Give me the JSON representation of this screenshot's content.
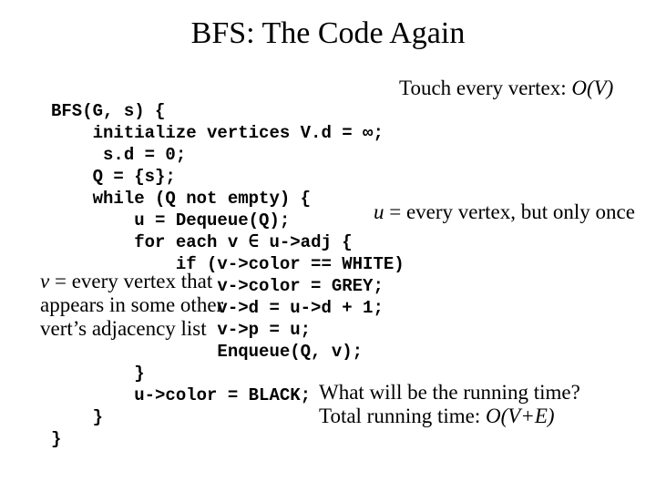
{
  "title": "BFS: The Code Again",
  "code": {
    "l0": "BFS(G, s) {",
    "l1": "    initialize vertices V.d = ∞;",
    "l2": "     s.d = 0;",
    "l3": "    Q = {s};",
    "l4": "    while (Q not empty) {",
    "l5": "        u = Dequeue(Q);",
    "l6": "        for each v ∈ u->adj {",
    "l7": "            if (v->color == WHITE)",
    "l8": "                v->color = GREY;",
    "l9": "                v->d = u->d + 1;",
    "l10": "                v->p = u;",
    "l11": "                Enqueue(Q, v);",
    "l12": "        }",
    "l13": "        u->color = BLACK;",
    "l14": "    }",
    "l15": "}"
  },
  "annotations": {
    "touch_prefix": "Touch every vertex: ",
    "touch_bigO": "O(V)",
    "u_var": "u",
    "u_rest": " = every vertex, but only once",
    "v_var": "v",
    "v_rest": " = every vertex that appears in some other vert’s adjacency list",
    "q1": "What will be the running time?",
    "q2_prefix": "Total running time: ",
    "q2_bigO": "O(V+E)"
  }
}
